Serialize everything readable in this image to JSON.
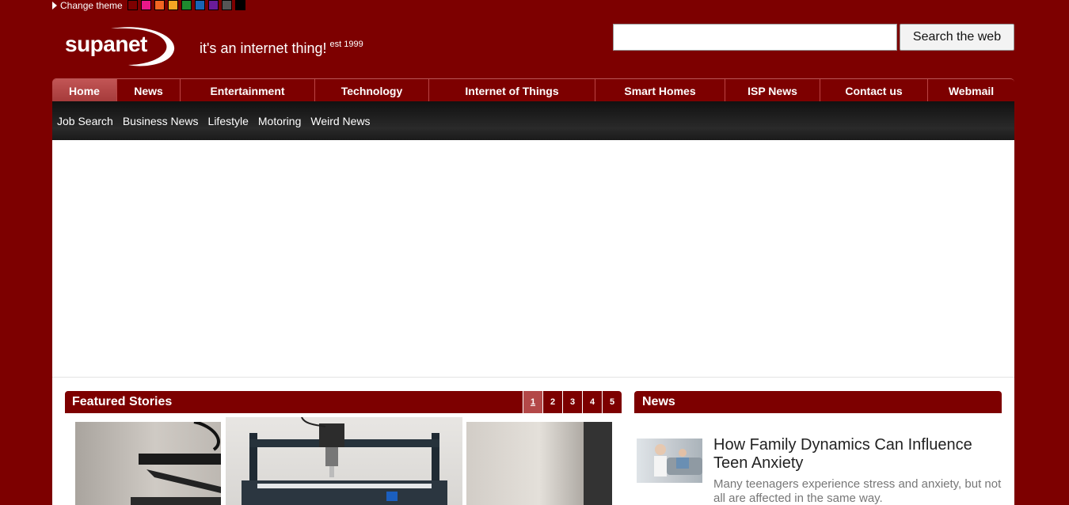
{
  "theme": {
    "label": "Change theme",
    "swatches": [
      {
        "name": "maroon",
        "color": "#7d0000"
      },
      {
        "name": "pink",
        "color": "#e8178a"
      },
      {
        "name": "orange",
        "color": "#f26522"
      },
      {
        "name": "amber",
        "color": "#f5a623"
      },
      {
        "name": "green",
        "color": "#1f8a2e"
      },
      {
        "name": "blue",
        "color": "#1a64b4"
      },
      {
        "name": "purple",
        "color": "#6a1b9a"
      },
      {
        "name": "grey",
        "color": "#555555"
      },
      {
        "name": "black",
        "color": "#000000"
      }
    ]
  },
  "header": {
    "logo_text": "supanet",
    "tagline": "it's an internet thing!",
    "tagline_sup": "est 1999",
    "search_value": "",
    "search_button": "Search the web"
  },
  "nav": {
    "items": [
      "Home",
      "News",
      "Entertainment",
      "Technology",
      "Internet of Things",
      "Smart Homes",
      "ISP News",
      "Contact us",
      "Webmail"
    ],
    "active": "Home"
  },
  "subnav": {
    "items": [
      "Job Search",
      "Business News",
      "Lifestyle",
      "Motoring",
      "Weird News"
    ]
  },
  "featured": {
    "title": "Featured Stories",
    "pages": [
      "1",
      "2",
      "3",
      "4",
      "5"
    ],
    "active_page": "1"
  },
  "news": {
    "title": "News",
    "headline": "How Family Dynamics Can Influence Teen Anxiety",
    "summary": "Many teenagers experience stress and anxiety, but not all are affected in the same way."
  },
  "colors": {
    "brand": "#7d0000",
    "active_tab": "#b34848",
    "subnav_bg": "#1a1a1a"
  }
}
